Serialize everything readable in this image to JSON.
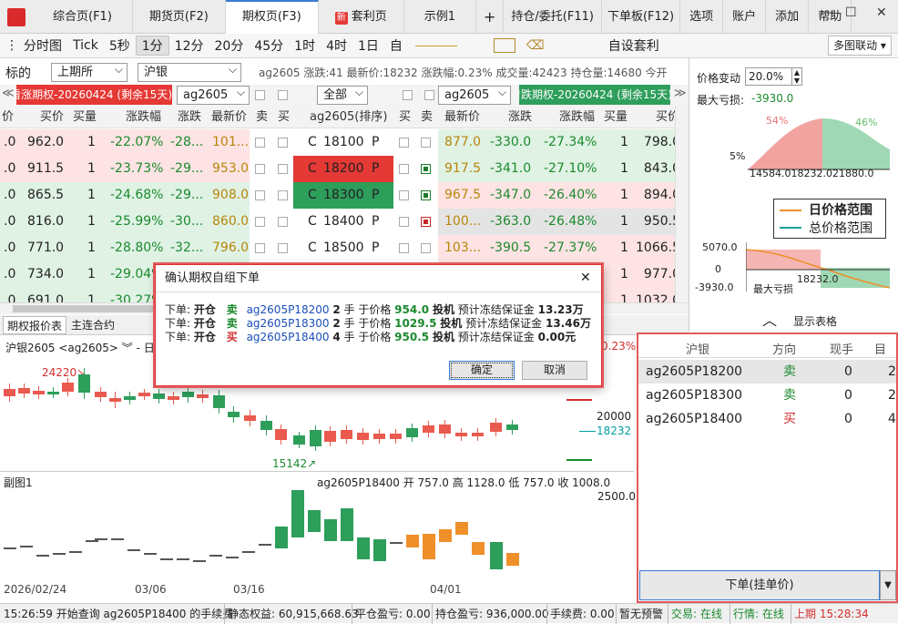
{
  "tabs": [
    "综合页(F1)",
    "期货页(F2)",
    "期权页(F3)",
    "套利页",
    "示例1",
    "+",
    "持仓/委托(F11)",
    "下单板(F12)",
    "选项",
    "账户",
    "添加",
    "帮助"
  ],
  "new_badge": "新",
  "win": {
    "min": "—",
    "max": "☐",
    "close": "✕"
  },
  "toolbar": {
    "items": [
      "分时图",
      "Tick",
      "5秒",
      "1分",
      "12分",
      "20分",
      "45分",
      "1时",
      "4时",
      "1日",
      "自"
    ],
    "arb": "自设套利",
    "link": "多图联动"
  },
  "filter": {
    "label": "标的",
    "exchange": "上期所",
    "product": "沪银",
    "summary": "ag2605 涨跌:41 最新价:18232 涨跌幅:0.23% 成交量:42423 持仓量:14680 今开"
  },
  "bar2": {
    "call_title": "看涨期权-20260424 (剩余15天)",
    "call_code": "ag2605",
    "all": "全部",
    "put_code": "ag2605",
    "put_title": "看跌期权-20260424 (剩余15天)"
  },
  "grid_header": [
    "价",
    "买价",
    "买量",
    "涨跌幅",
    "涨跌",
    "最新价",
    "卖",
    "买",
    "ag2605(排序)",
    "买",
    "卖",
    "最新价",
    "涨跌",
    "涨跌幅",
    "买量",
    "买价"
  ],
  "rows": [
    {
      "c1": ".0",
      "bid": "962.0",
      "vol": "1",
      "pct": "-22.07%",
      "chg": "-28...",
      "last": "101...",
      "strike": "18100",
      "plast": "877.0",
      "pchg": "-330.0",
      "ppct": "-27.34%",
      "pvol": "1",
      "pbid": "798.0"
    },
    {
      "c1": ".0",
      "bid": "911.5",
      "vol": "1",
      "pct": "-23.73%",
      "chg": "-29...",
      "last": "953.0",
      "strike": "18200",
      "plast": "917.5",
      "pchg": "-341.0",
      "ppct": "-27.10%",
      "pvol": "1",
      "pbid": "843.0"
    },
    {
      "c1": ".0",
      "bid": "865.5",
      "vol": "1",
      "pct": "-24.68%",
      "chg": "-29...",
      "last": "908.0",
      "strike": "18300",
      "plast": "967.5",
      "pchg": "-347.0",
      "ppct": "-26.40%",
      "pvol": "1",
      "pbid": "894.0"
    },
    {
      "c1": ".0",
      "bid": "816.0",
      "vol": "1",
      "pct": "-25.99%",
      "chg": "-30...",
      "last": "860.0",
      "strike": "18400",
      "plast": "100...",
      "pchg": "-363.0",
      "ppct": "-26.48%",
      "pvol": "1",
      "pbid": "950.5"
    },
    {
      "c1": ".0",
      "bid": "771.0",
      "vol": "1",
      "pct": "-28.80%",
      "chg": "-32...",
      "last": "796.0",
      "strike": "18500",
      "plast": "103...",
      "pchg": "-390.5",
      "ppct": "-27.37%",
      "pvol": "1",
      "pbid": "1066.5"
    },
    {
      "c1": ".0",
      "bid": "734.0",
      "vol": "1",
      "pct": "-29.04%",
      "chg": "",
      "last": "",
      "strike": "",
      "plast": "",
      "pchg": "",
      "ppct": "",
      "pvol": "1",
      "pbid": "977.0"
    },
    {
      "c1": ".0",
      "bid": "691.0",
      "vol": "1",
      "pct": "-30.27%",
      "chg": "",
      "last": "",
      "strike": "",
      "plast": "",
      "pchg": "",
      "ppct": "",
      "pvol": "1",
      "pbid": "1032.0"
    }
  ],
  "cp": {
    "c": "C",
    "p": "P"
  },
  "bottom_tabs": {
    "quote": "期权报价表",
    "main": "主连合约"
  },
  "chart1": {
    "title": "沪银2605 <ag2605> ︾ - 日线",
    "pct": "0.23%",
    "high": "24220↘",
    "low": "15142↗",
    "level1": "20000",
    "level2": "18232"
  },
  "chart2": {
    "title": "副图1",
    "info": "ag2605P18400 开 757.0 高 1128.0 低 757.0 收 1008.0",
    "level": "2500.0"
  },
  "dates": [
    "2026/02/24",
    "03/06",
    "03/16",
    "04/01"
  ],
  "dialog": {
    "title": "确认期权自组下单",
    "close": "✕",
    "ok": "确定",
    "cancel": "取消",
    "lines": [
      {
        "pre": "下单:",
        "open": "开仓",
        "side": "卖",
        "code": "ag2605P18200",
        "qty": "2",
        "mid": "手 于价格",
        "price": "954.0",
        "kind": "投机",
        "mlabel": "预计冻结保证金",
        "margin": "13.23万"
      },
      {
        "pre": "下单:",
        "open": "开仓",
        "side": "卖",
        "code": "ag2605P18300",
        "qty": "2",
        "mid": "手 于价格",
        "price": "1029.5",
        "kind": "投机",
        "mlabel": "预计冻结保证金",
        "margin": "13.46万"
      },
      {
        "pre": "下单:",
        "open": "开仓",
        "side": "买",
        "code": "ag2605P18400",
        "qty": "4",
        "mid": "手 于价格",
        "price": "950.5",
        "kind": "投机",
        "mlabel": "预计冻结保证金",
        "margin": "0.00元"
      }
    ]
  },
  "rpanel": {
    "price_change_label": "价格变动",
    "price_change": "20.0%",
    "max_loss_label": "最大亏损:",
    "max_loss": "-3930.0",
    "pct_left": "54%",
    "pct_right": "46%",
    "ylab": "5%",
    "xlabs": "14584.018232.021880.0",
    "legend1": "日价格范围",
    "legend2": "总价格范围",
    "pl_top": "5070.0",
    "pl_mid": "0",
    "pl_bot": "-3930.0",
    "pl_loss": "最大亏损",
    "pl_x": "18232.0",
    "show_table": "显示表格"
  },
  "orders": {
    "headers": [
      "沪银",
      "方向",
      "现手",
      "目标"
    ],
    "rows": [
      {
        "code": "ag2605P18200",
        "dir": "卖",
        "cur": "0",
        "tgt": "2"
      },
      {
        "code": "ag2605P18300",
        "dir": "卖",
        "cur": "0",
        "tgt": "2"
      },
      {
        "code": "ag2605P18400",
        "dir": "买",
        "cur": "0",
        "tgt": "4"
      }
    ],
    "submit": "下单(挂单价)"
  },
  "status": {
    "msg": "15:26:59 开始查询 ag2605P18400 的手续费",
    "equity": "静态权益: 60,915,668.63",
    "close_pl": "平仓盈亏: 0.00",
    "pos_pl": "持仓盈亏: 936,000.00",
    "fee": "手续费: 0.00",
    "warn": "暂无预警",
    "trade": "交易: 在线",
    "quote": "行情: 在线",
    "time": "上期 15:28:34"
  }
}
